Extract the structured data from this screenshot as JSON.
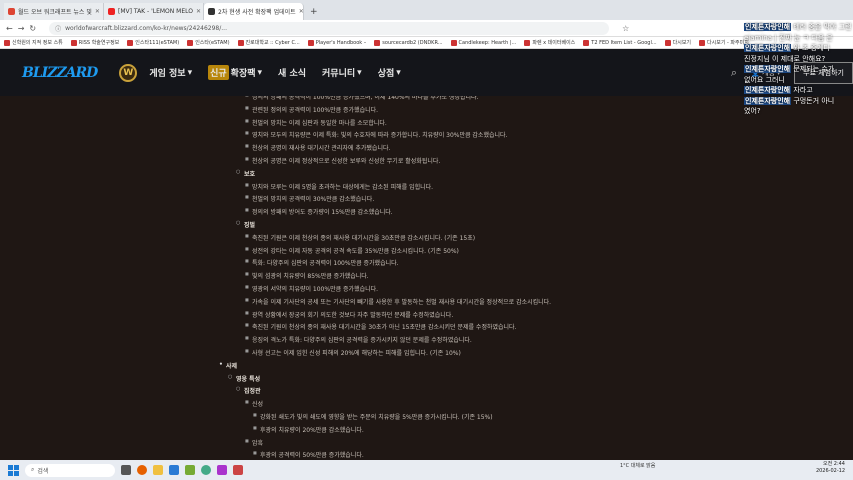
{
  "browser": {
    "tabs": [
      {
        "label": "월드 오브 워크래프트 뉴스 및",
        "color": "#d43"
      },
      {
        "label": "[MV] TAK - 'LEMON MELO",
        "color": "#e22"
      },
      {
        "label": "2차 현생 사전 확장팩 업데이트",
        "color": "#333",
        "active": true
      }
    ],
    "new_tab": "+",
    "url": "worldofwarcraft.blizzard.com/ko-kr/news/24246298/...",
    "bookmarks": [
      "신학원의 지적 정보 스튜",
      "RISS 학술연구정보",
      "인스타111(eSTAM)",
      "인스타(eSTAM)",
      "진로대학교 :: Cyber C...",
      "Player's Handbook –",
      "sourcecardb2 (DNDKR...",
      "Candlekeep: Hearth |...",
      "파렌 x 데이터베이스",
      "T2 FED Item List - Googl...",
      "다시보기",
      "다시보기 - 파주미치"
    ]
  },
  "site": {
    "logo": "BLIZZARD",
    "game_logo": "W",
    "menu": [
      {
        "label": "게임 정보",
        "chevron": true
      },
      {
        "label": "확장팩",
        "badge": "신규",
        "chevron": true
      },
      {
        "label": "새 소식",
        "chevron": false
      },
      {
        "label": "커뮤니티",
        "chevron": true
      },
      {
        "label": "상점",
        "chevron": true
      }
    ],
    "account_label": "계정",
    "free_button": "무료 체험하기"
  },
  "article": {
    "lines": [
      {
        "text": "정의의 방패의 공격력이 100%만큼 증가했으며, 이제 140%의 마나를 추가로 생성합니다.",
        "lvl": 3
      },
      {
        "text": "관련된 정의의 공격력이 100%만큼 증가했습니다.",
        "lvl": 3
      },
      {
        "text": "천벌의 망치는 이제 심판과 동일한 마나를 소모합니다.",
        "lvl": 3
      },
      {
        "text": "영치와 모두의 치유량은 이제 특화: 빛의 수호자에 따라 증가합니다. 치유량이 30%만큼 감소했습니다.",
        "lvl": 3
      },
      {
        "text": "천상의 공명이 재사용 대기시간 관리자에 추가됐습니다.",
        "lvl": 3
      },
      {
        "text": "천상의 공명은 이제 정상적으로 신성한 보루와 신성한 무기로 활성화됩니다.",
        "lvl": 3
      },
      {
        "text": "보호",
        "lvl": 2
      },
      {
        "text": "망치와 모루는 이제 5명을 초과하는 대상에게는 감소된 피해를 입힙니다.",
        "lvl": 3
      },
      {
        "text": "천벌의 망치의 공격력이 30%만큼 감소했습니다.",
        "lvl": 3
      },
      {
        "text": "정의의 방패의 방어도 증가량이 15%만큼 감소했습니다.",
        "lvl": 3
      },
      {
        "text": "징벌",
        "lvl": 2
      },
      {
        "text": "축진된 기원은 이제 천상의 종의 재사용 대기시간을 30초만큼 감소시킵니다. (기존 15초)",
        "lvl": 3
      },
      {
        "text": "성전의 강타는 이제 자동 공격의 공격 속도를 35%만큼 감소시킵니다. (기존 50%)",
        "lvl": 3
      },
      {
        "text": "특화: 다양주의 심판의 공격력이 100%만큼 증가했습니다.",
        "lvl": 3
      },
      {
        "text": "빛의 섬광의 치유량이 85%만큼 증가했습니다.",
        "lvl": 3
      },
      {
        "text": "영광의 서약의 치유량이 100%만큼 증가했습니다.",
        "lvl": 3
      },
      {
        "text": "가속을 이제 기사단의 공세 또는 기사단의 빼기를 사용한 후 발동하는 천벌 재사용 대기시간을 정상적으로 감소시킵니다.",
        "lvl": 3
      },
      {
        "text": "광역 상황에서 장궁의 회기 의도한 것보다 자주 발동하던 문제를 수정하였습니다.",
        "lvl": 3
      },
      {
        "text": "축진된 기원이 천상의 종의 재사용 대기시간을 30초가 아닌 15초만큼 감소시키던 문제를 수정하였습니다.",
        "lvl": 3
      },
      {
        "text": "응징의 격노가 특화: 다양주의 심판의 공격력을 증가시키지 않던 문제를 수정하였습니다.",
        "lvl": 3
      },
      {
        "text": "사형 선고는 이제 입힌 신성 피해의 20%에 해당하는 피해를 입힙니다. (기존 10%)",
        "lvl": 3
      },
      {
        "text": "사제",
        "lvl": 0
      },
      {
        "text": "영웅 특성",
        "lvl": 1
      },
      {
        "text": "집정관",
        "lvl": 2
      },
      {
        "text": "신성",
        "lvl": 3
      },
      {
        "text": "강화된 쇄도가 빛의 쇄도에 영향을 받는 주문의 치유량을 5%만큼 증가시킵니다. (기존 15%)",
        "lvl": 4
      },
      {
        "text": "후광의 치유량이 20%만큼 감소했습니다.",
        "lvl": 4
      },
      {
        "text": "암흑",
        "lvl": 3
      },
      {
        "text": "후광의 공격력이 50%만큼 증가했습니다.",
        "lvl": 4
      }
    ]
  },
  "chat": {
    "lines": [
      {
        "name": "인제튼자랑인해",
        "text": "테러 중을 막아 그런"
      },
      {
        "name": "",
        "text": "ejamina",
        "extra": "| 진짜 눈 ㅋ 다음 은"
      },
      {
        "name": "인제튼자랑인해",
        "text": "와 조 중계다"
      },
      {
        "name": "",
        "text": "진정지님 이 제대로 안해요?"
      },
      {
        "name": "인제튼자랑인해",
        "text": "문제되는 수가"
      },
      {
        "name": "",
        "text": "없어요 그러니"
      },
      {
        "name": "인제튼자랑인해",
        "text": "자라고"
      },
      {
        "name": "인제튼자랑인해",
        "text": "구멍돈거 아니"
      },
      {
        "name": "",
        "text": "였어?"
      }
    ]
  },
  "taskbar": {
    "search_placeholder": "검색",
    "weather": "1°C 대체로 맑음",
    "time": "오전 2:44",
    "date": "2026-02-12"
  }
}
